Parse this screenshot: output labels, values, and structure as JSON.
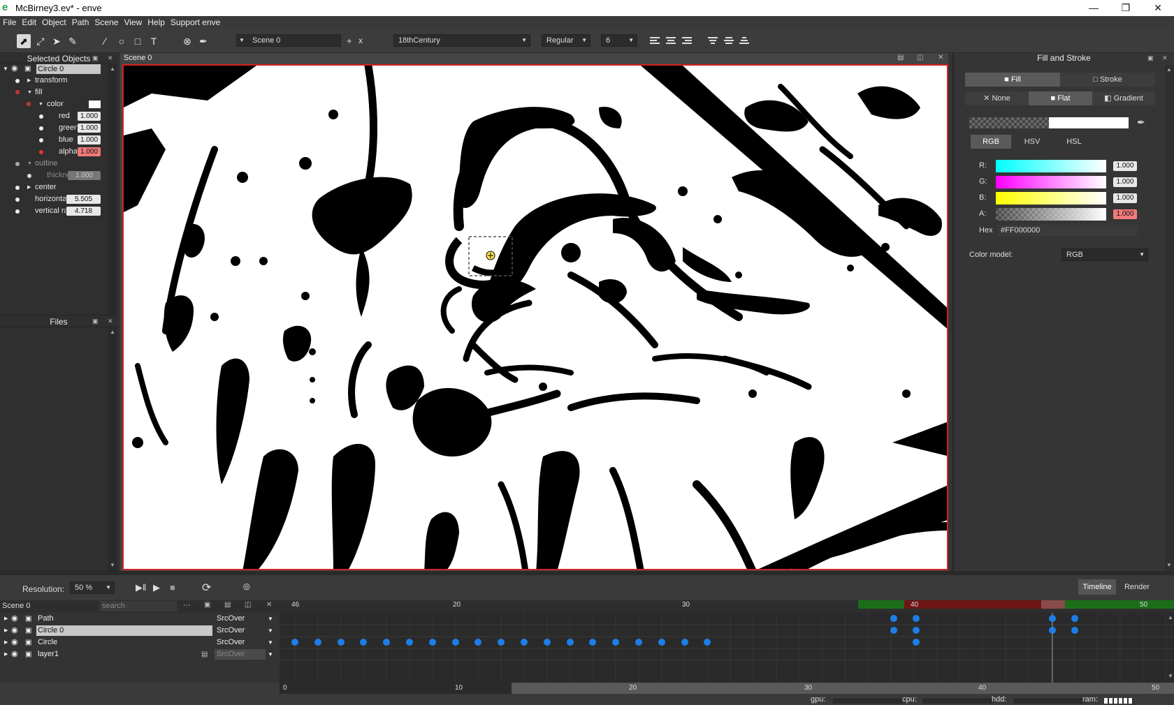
{
  "window": {
    "title": "McBirney3.ev* - enve"
  },
  "menu": [
    "File",
    "Edit",
    "Object",
    "Path",
    "Scene",
    "View",
    "Help",
    "Support enve"
  ],
  "toolbar": {
    "scene_name": "Scene 0",
    "scene_add": "+",
    "scene_remove": "x",
    "font_family": "18thCentury",
    "font_style": "Regular",
    "font_size": "6"
  },
  "canvas": {
    "tab_title": "Scene 0"
  },
  "selected_objects": {
    "title": "Selected Objects",
    "object_name": "Circle 0",
    "props": {
      "transform": "transform",
      "fill": "fill",
      "color": "color",
      "red": "red",
      "red_val": "1.000",
      "green": "green",
      "green_val": "1.000",
      "blue": "blue",
      "blue_val": "1.000",
      "alpha": "alpha",
      "alpha_val": "1.000",
      "outline": "outline",
      "thickness": "thickness",
      "thickness_val": "1.000",
      "center": "center",
      "horizontal": "horizontal radius",
      "horizontal_val": "5.505",
      "vertical": "vertical radius",
      "vertical_val": "4.718"
    }
  },
  "files": {
    "title": "Files"
  },
  "fill_stroke": {
    "title": "Fill and Stroke",
    "tab_fill": "Fill",
    "tab_stroke": "Stroke",
    "mode_none": "None",
    "mode_flat": "Flat",
    "mode_gradient": "Gradient",
    "model_rgb": "RGB",
    "model_hsv": "HSV",
    "model_hsl": "HSL",
    "r_label": "R:",
    "r_val": "1.000",
    "g_label": "G:",
    "g_val": "1.000",
    "b_label": "B:",
    "b_val": "1.000",
    "a_label": "A:",
    "a_val": "1.000",
    "hex_label": "Hex",
    "hex_val": "#FF000000",
    "color_model_label": "Color model:",
    "color_model_val": "RGB"
  },
  "playback": {
    "resolution_label": "Resolution:",
    "resolution_val": "50",
    "resolution_unit": "%"
  },
  "bottom_tabs": {
    "timeline": "Timeline",
    "render": "Render"
  },
  "timeline": {
    "scene": "Scene 0",
    "search_placeholder": "search",
    "more": "···",
    "layers": [
      {
        "name": "Path",
        "blend": "SrcOver"
      },
      {
        "name": "Circle 0",
        "blend": "SrcOver"
      },
      {
        "name": "Circle",
        "blend": "SrcOver"
      },
      {
        "name": "layer1",
        "blend": "SrcOver"
      }
    ],
    "top_ruler": [
      "46",
      "20",
      "30",
      "40",
      "50"
    ],
    "bottom_ruler": [
      "0",
      "10",
      "20",
      "30",
      "40",
      "50"
    ]
  },
  "status": {
    "gpu": "gpu:",
    "cpu": "cpu:",
    "hdd": "hdd:",
    "ram": "ram:"
  },
  "colors": {
    "accent_red": "#d42020",
    "keyframe": "#1e7ee8",
    "green_range": "#1a6e1a",
    "red_range": "#6e1414"
  }
}
